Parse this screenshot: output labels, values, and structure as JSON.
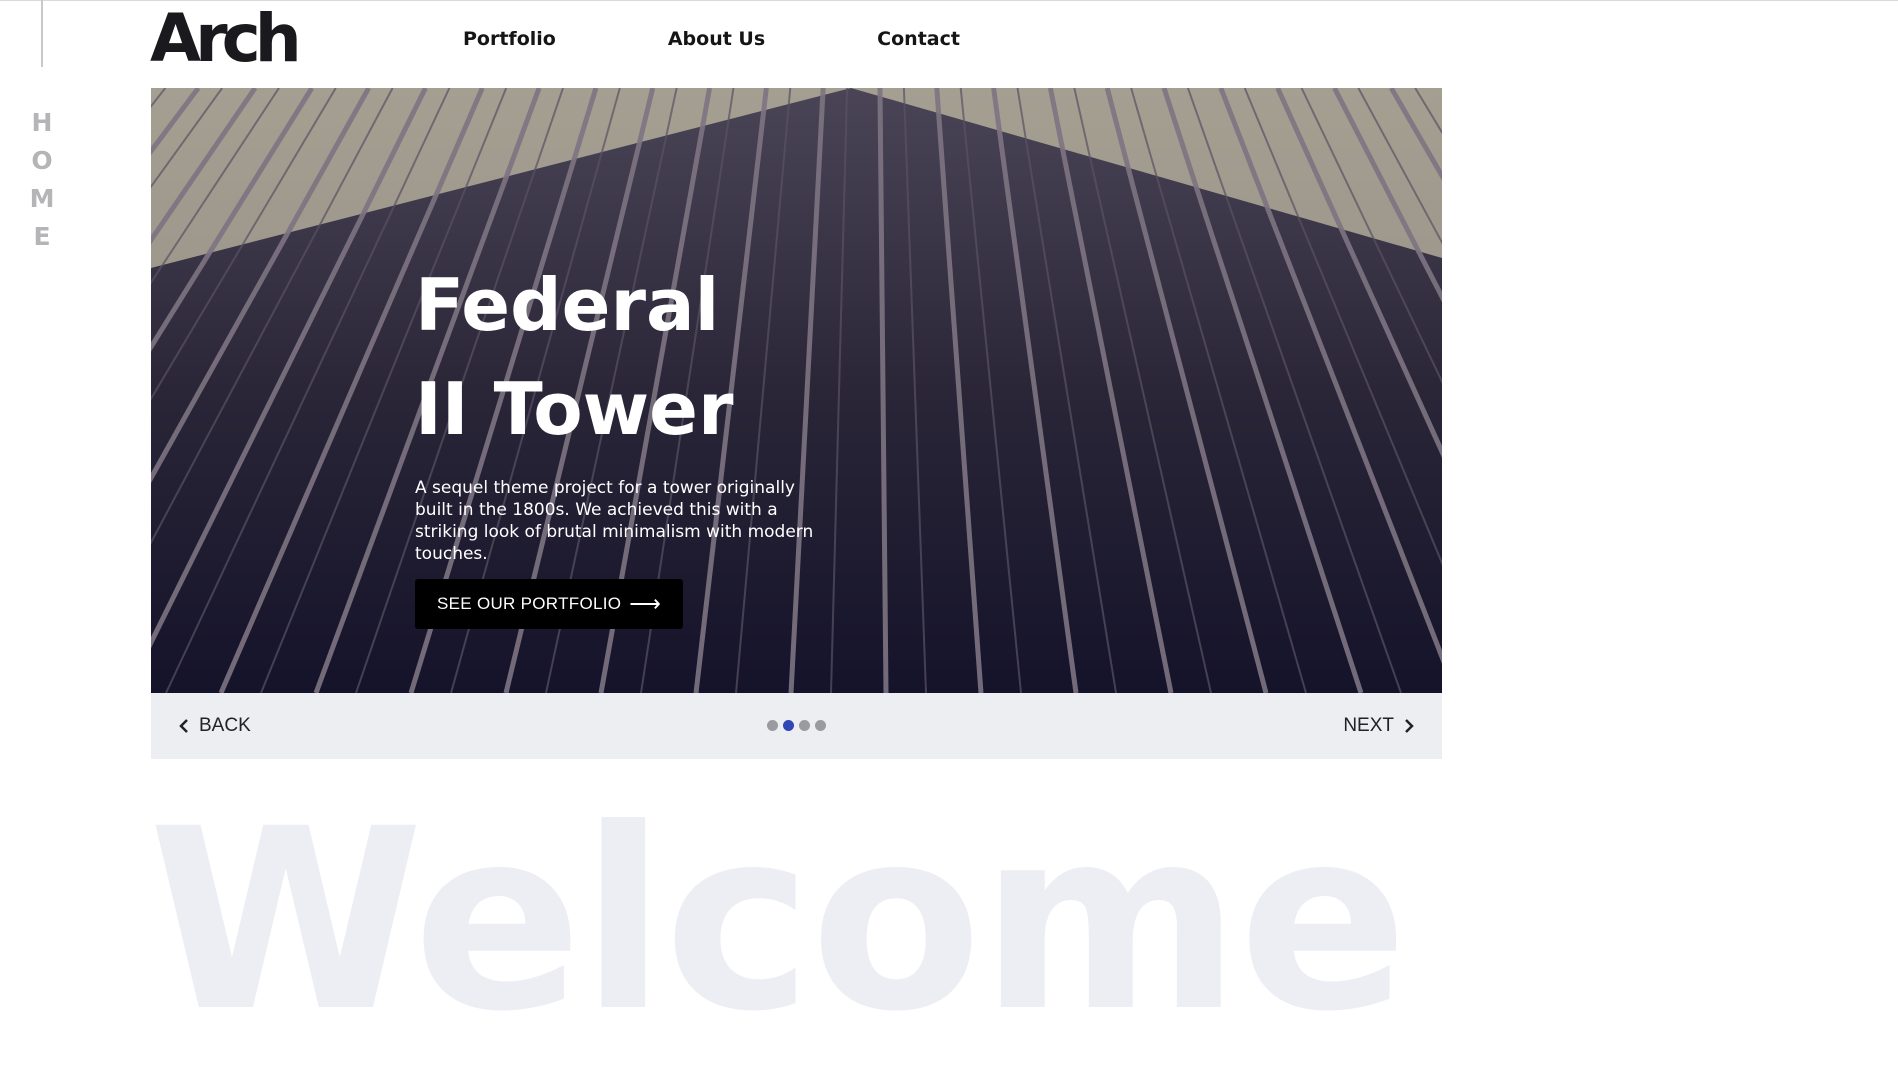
{
  "side_label": [
    "H",
    "O",
    "M",
    "E"
  ],
  "logo": {
    "text": "Arch"
  },
  "nav": {
    "items": [
      {
        "label": "Portfolio"
      },
      {
        "label": "About Us"
      },
      {
        "label": "Contact"
      }
    ]
  },
  "hero": {
    "title": "Federal II Tower",
    "description": "A sequel theme project for a tower originally built in the 1800s. We achieved this with a striking look of brutal minimalism with modern touches.",
    "cta_label": "SEE OUR PORTFOLIO",
    "cta_icon": "arrow-right-icon"
  },
  "slider": {
    "back_label": "BACK",
    "next_label": "NEXT",
    "dot_count": 4,
    "active_dot": 2,
    "active_color": "#3047b5"
  },
  "welcome": {
    "text": "Welcome"
  }
}
